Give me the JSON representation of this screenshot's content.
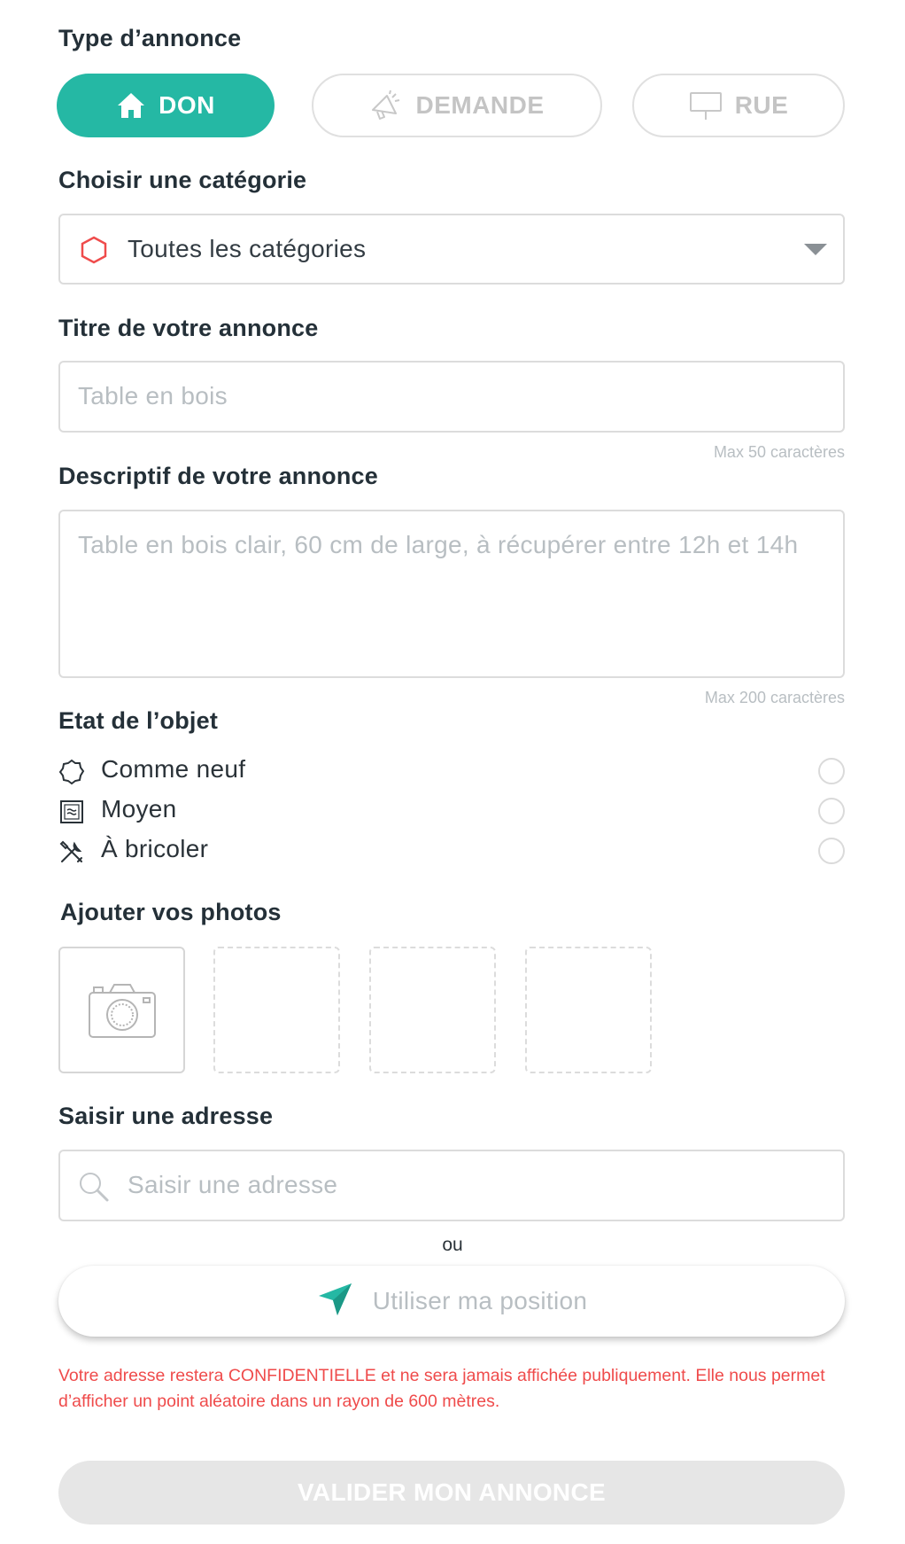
{
  "sections": {
    "type_title": "Type d’annonce",
    "category_title": "Choisir une catégorie",
    "title_title": "Titre de votre annonce",
    "description_title": "Descriptif de votre annonce",
    "condition_title": "Etat de l’objet",
    "photos_title": "Ajouter vos photos",
    "address_title": "Saisir une adresse"
  },
  "type_buttons": [
    {
      "label": "DON",
      "icon": "house-icon",
      "active": true
    },
    {
      "label": "DEMANDE",
      "icon": "megaphone-icon",
      "active": false
    },
    {
      "label": "RUE",
      "icon": "street-sign-icon",
      "active": false
    }
  ],
  "category": {
    "value": "Toutes les catégories",
    "icon": "hexagon-icon",
    "icon_color": "#ef4b4b"
  },
  "title_field": {
    "placeholder": "Table en bois",
    "hint": "Max 50 caractères"
  },
  "description_field": {
    "placeholder": "Table en bois clair, 60 cm de large, à récupérer entre 12h et 14h",
    "hint": "Max 200 caractères"
  },
  "conditions": [
    {
      "label": "Comme neuf",
      "icon": "badge-icon"
    },
    {
      "label": "Moyen",
      "icon": "approx-box-icon"
    },
    {
      "label": "À bricoler",
      "icon": "tools-icon"
    }
  ],
  "photos": {
    "icon": "camera-icon",
    "empty_slots": 3
  },
  "address": {
    "placeholder": "Saisir une adresse",
    "icon": "search-icon",
    "or_label": "ou",
    "position_label": "Utiliser ma position",
    "position_icon": "location-arrow-icon"
  },
  "notice": "Votre adresse restera CONFIDENTIELLE et ne sera jamais affichée publiquement. Elle nous permet d’afficher un point aléatoire dans un rayon de 600 mètres.",
  "submit_label": "VALIDER MON ANNONCE",
  "colors": {
    "accent": "#25b8a4",
    "warning": "#ef4b4b",
    "disabled": "#e6e6e6"
  }
}
